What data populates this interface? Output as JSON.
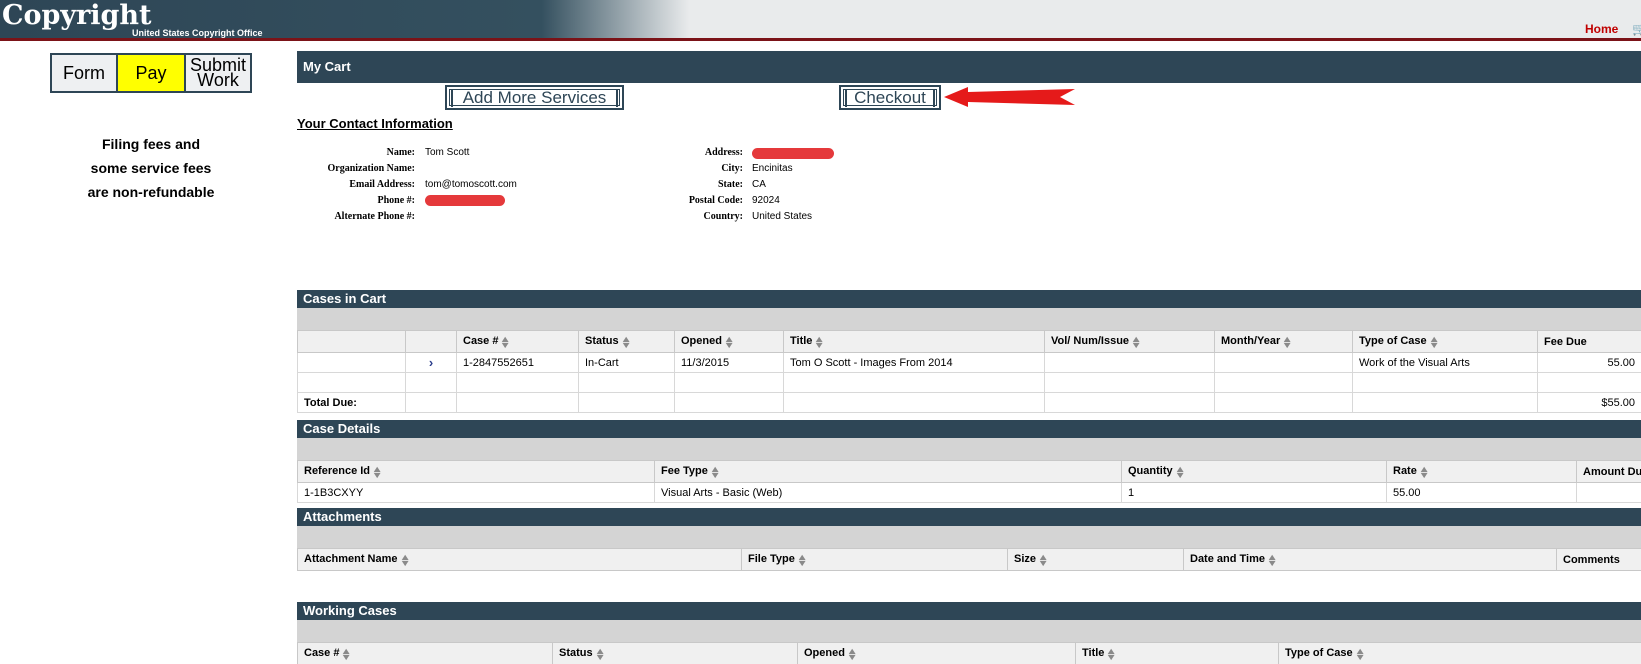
{
  "header": {
    "logo_main": "Copyright",
    "logo_sub": "United States Copyright Office",
    "home_link": "Home",
    "cart_icon": "cart-icon"
  },
  "steps": [
    {
      "label": "Form",
      "active": false
    },
    {
      "label": "Pay",
      "active": true
    },
    {
      "label": "Submit Work",
      "active": false
    }
  ],
  "fees_note": [
    "Filing fees and",
    "some service fees",
    "are non-refundable"
  ],
  "cart": {
    "title": "My Cart",
    "add_more_label": "Add More Services",
    "checkout_label": "Checkout"
  },
  "contact": {
    "title": "Your Contact Information",
    "name_label": "Name:",
    "name": "Tom Scott",
    "org_label": "Organization Name:",
    "org": "",
    "email_label": "Email Address:",
    "email": "tom@tomoscott.com",
    "phone_label": "Phone #:",
    "alt_phone_label": "Alternate Phone #:",
    "address_label": "Address:",
    "city_label": "City:",
    "city": "Encinitas",
    "state_label": "State:",
    "state": "CA",
    "postal_label": "Postal Code:",
    "postal": "92024",
    "country_label": "Country:",
    "country": "United States"
  },
  "cases_in_cart": {
    "title": "Cases in Cart",
    "headers": [
      "Case #",
      "Status",
      "Opened",
      "Title",
      "Vol/ Num/Issue",
      "Month/Year",
      "Type of Case",
      "Fee Due"
    ],
    "row": {
      "case_no": "1-2847552651",
      "status": "In-Cart",
      "opened": "11/3/2015",
      "title": "Tom O Scott - Images From 2014",
      "vol": "",
      "month_year": "",
      "type": "Work of the Visual Arts",
      "fee": "55.00"
    },
    "total_label": "Total Due:",
    "total": "$55.00"
  },
  "case_details": {
    "title": "Case Details",
    "headers": [
      "Reference Id",
      "Fee Type",
      "Quantity",
      "Rate",
      "Amount Due"
    ],
    "row": {
      "reference": "1-1B3CXYY",
      "fee_type": "Visual Arts - Basic (Web)",
      "quantity": "1",
      "rate": "55.00",
      "amount": ""
    }
  },
  "attachments": {
    "title": "Attachments",
    "headers": [
      "Attachment Name",
      "File Type",
      "Size",
      "Date and Time",
      "Comments"
    ]
  },
  "working_cases": {
    "title": "Working Cases",
    "headers": [
      "Case #",
      "Status",
      "Opened",
      "Title",
      "Type of Case"
    ]
  },
  "colors": {
    "navy": "#2e4656",
    "active_step": "#ffff00",
    "redaction": "#e5393b",
    "home": "#c00000"
  }
}
